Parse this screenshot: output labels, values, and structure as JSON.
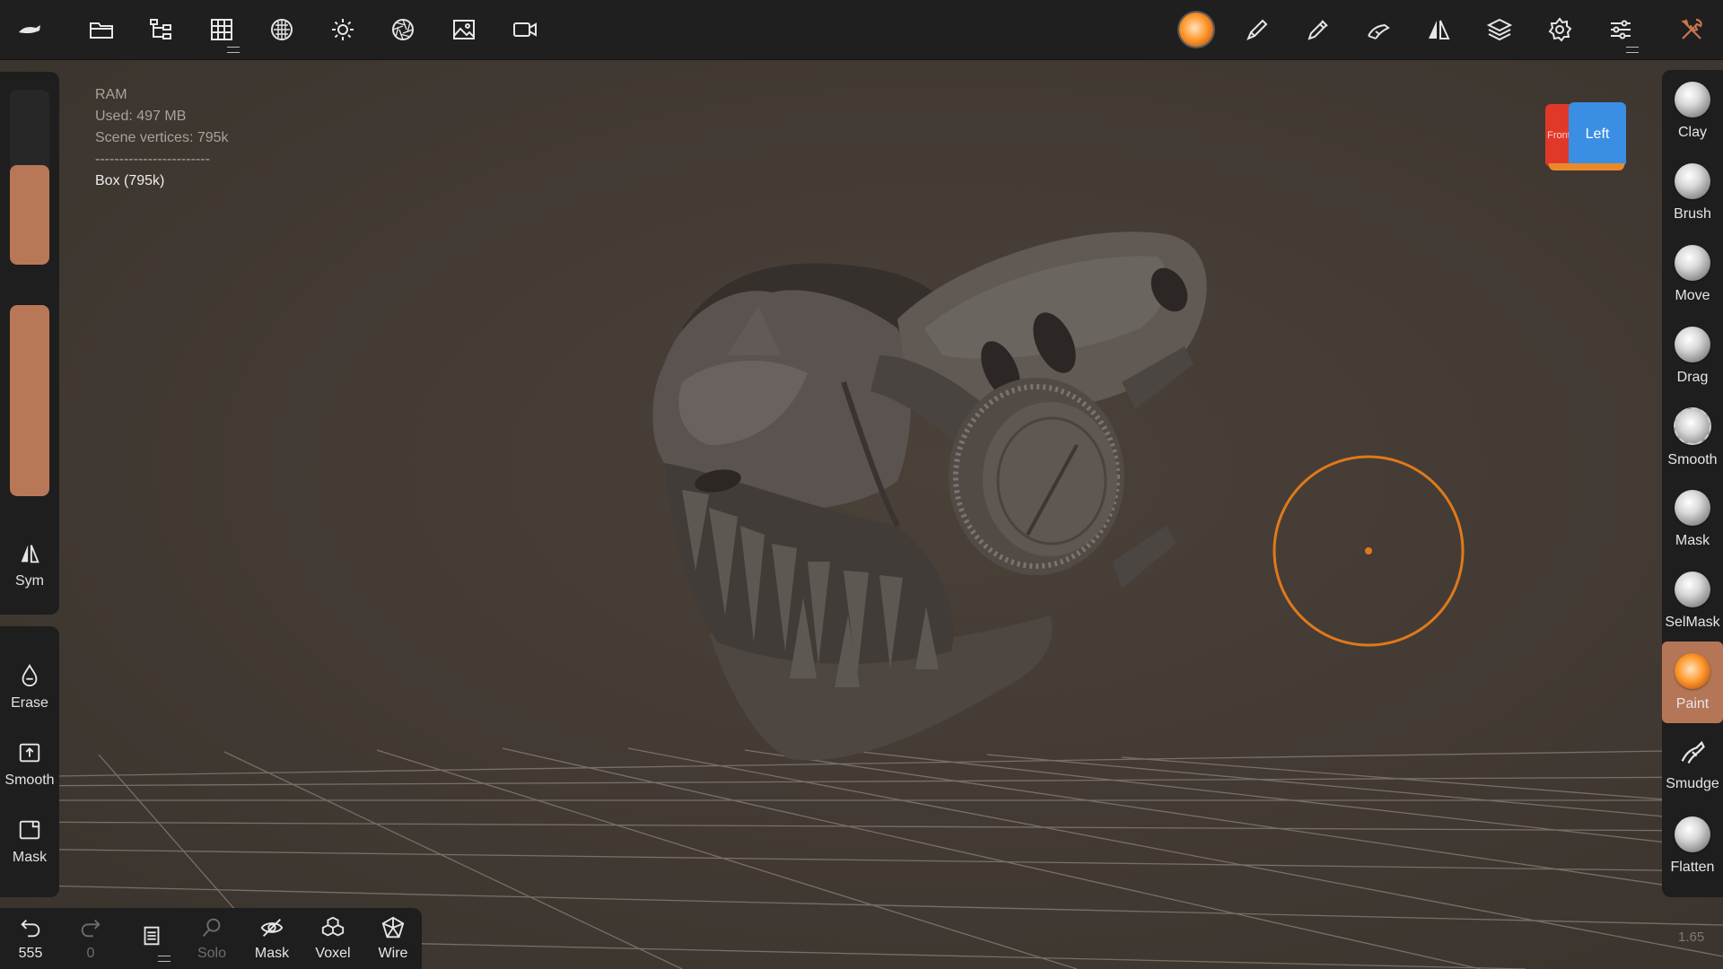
{
  "info": {
    "ram_label": "RAM",
    "used": "Used: 497 MB",
    "vertices": "Scene vertices: 795k",
    "divider": "------------------------",
    "mesh": "Box (795k)"
  },
  "top_toolbar": {
    "left_icons": [
      "app-logo-icon",
      "folder-icon",
      "scene-tree-icon",
      "topology-grid-icon",
      "material-sphere-icon",
      "light-icon",
      "camera-aperture-icon",
      "image-icon",
      "video-camera-icon"
    ],
    "right_icons": [
      "material-ball-icon",
      "pen-icon",
      "eyedropper-icon",
      "stroke-hand-icon",
      "symmetry-icon",
      "layers-icon",
      "settings-icon",
      "sliders-icon",
      "tools-icon"
    ]
  },
  "left_panel": {
    "size_slider_value": 0.57,
    "intensity_slider_value": 1.0,
    "sym_label": "Sym",
    "erase_label": "Erase",
    "smooth_label": "Smooth",
    "mask_label": "Mask"
  },
  "bottom_bar": {
    "undo_count": "555",
    "redo_count": "0",
    "solo_label": "Solo",
    "mask_label": "Mask",
    "voxel_label": "Voxel",
    "wire_label": "Wire"
  },
  "tools": [
    {
      "label": "Clay",
      "icon": "clay-sphere-icon"
    },
    {
      "label": "Brush",
      "icon": "brush-sphere-icon"
    },
    {
      "label": "Move",
      "icon": "move-sphere-icon"
    },
    {
      "label": "Drag",
      "icon": "drag-sphere-icon"
    },
    {
      "label": "Smooth",
      "icon": "smooth-sphere-icon"
    },
    {
      "label": "Mask",
      "icon": "mask-sphere-icon"
    },
    {
      "label": "SelMask",
      "icon": "selmask-sphere-icon"
    },
    {
      "label": "Paint",
      "icon": "paint-sphere-icon",
      "active": true
    },
    {
      "label": "Smudge",
      "icon": "smudge-icon"
    },
    {
      "label": "Flatten",
      "icon": "flatten-sphere-icon"
    }
  ],
  "navcube": {
    "front": "Front",
    "left": "Left"
  },
  "zoom": "1.65",
  "colors": {
    "accent": "#b87757",
    "brush_cursor": "#e0791a",
    "background": "#403831",
    "panel": "#1e1e1e"
  }
}
